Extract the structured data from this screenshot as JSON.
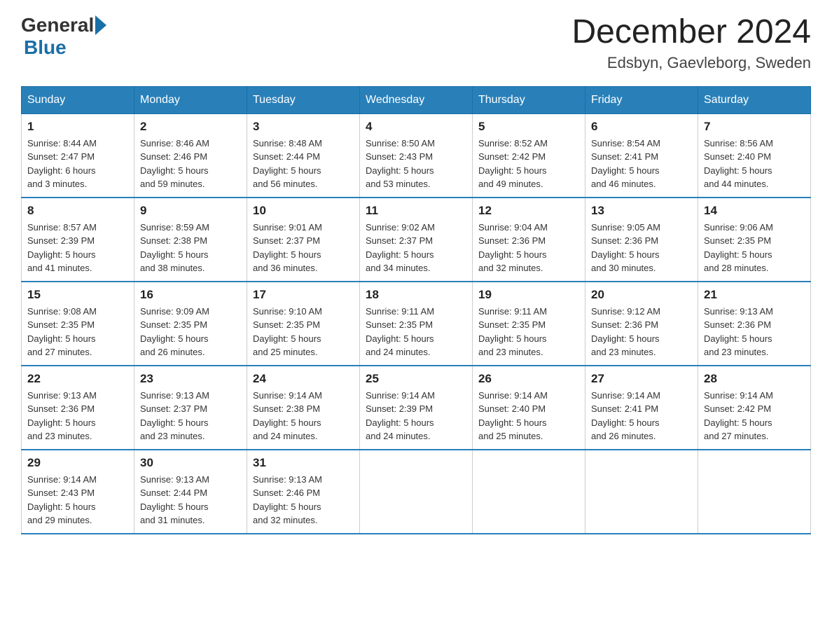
{
  "logo": {
    "general": "General",
    "blue": "Blue"
  },
  "title": "December 2024",
  "subtitle": "Edsbyn, Gaevleborg, Sweden",
  "days_of_week": [
    "Sunday",
    "Monday",
    "Tuesday",
    "Wednesday",
    "Thursday",
    "Friday",
    "Saturday"
  ],
  "weeks": [
    [
      {
        "day": "1",
        "sunrise": "Sunrise: 8:44 AM",
        "sunset": "Sunset: 2:47 PM",
        "daylight": "Daylight: 6 hours",
        "daylight2": "and 3 minutes."
      },
      {
        "day": "2",
        "sunrise": "Sunrise: 8:46 AM",
        "sunset": "Sunset: 2:46 PM",
        "daylight": "Daylight: 5 hours",
        "daylight2": "and 59 minutes."
      },
      {
        "day": "3",
        "sunrise": "Sunrise: 8:48 AM",
        "sunset": "Sunset: 2:44 PM",
        "daylight": "Daylight: 5 hours",
        "daylight2": "and 56 minutes."
      },
      {
        "day": "4",
        "sunrise": "Sunrise: 8:50 AM",
        "sunset": "Sunset: 2:43 PM",
        "daylight": "Daylight: 5 hours",
        "daylight2": "and 53 minutes."
      },
      {
        "day": "5",
        "sunrise": "Sunrise: 8:52 AM",
        "sunset": "Sunset: 2:42 PM",
        "daylight": "Daylight: 5 hours",
        "daylight2": "and 49 minutes."
      },
      {
        "day": "6",
        "sunrise": "Sunrise: 8:54 AM",
        "sunset": "Sunset: 2:41 PM",
        "daylight": "Daylight: 5 hours",
        "daylight2": "and 46 minutes."
      },
      {
        "day": "7",
        "sunrise": "Sunrise: 8:56 AM",
        "sunset": "Sunset: 2:40 PM",
        "daylight": "Daylight: 5 hours",
        "daylight2": "and 44 minutes."
      }
    ],
    [
      {
        "day": "8",
        "sunrise": "Sunrise: 8:57 AM",
        "sunset": "Sunset: 2:39 PM",
        "daylight": "Daylight: 5 hours",
        "daylight2": "and 41 minutes."
      },
      {
        "day": "9",
        "sunrise": "Sunrise: 8:59 AM",
        "sunset": "Sunset: 2:38 PM",
        "daylight": "Daylight: 5 hours",
        "daylight2": "and 38 minutes."
      },
      {
        "day": "10",
        "sunrise": "Sunrise: 9:01 AM",
        "sunset": "Sunset: 2:37 PM",
        "daylight": "Daylight: 5 hours",
        "daylight2": "and 36 minutes."
      },
      {
        "day": "11",
        "sunrise": "Sunrise: 9:02 AM",
        "sunset": "Sunset: 2:37 PM",
        "daylight": "Daylight: 5 hours",
        "daylight2": "and 34 minutes."
      },
      {
        "day": "12",
        "sunrise": "Sunrise: 9:04 AM",
        "sunset": "Sunset: 2:36 PM",
        "daylight": "Daylight: 5 hours",
        "daylight2": "and 32 minutes."
      },
      {
        "day": "13",
        "sunrise": "Sunrise: 9:05 AM",
        "sunset": "Sunset: 2:36 PM",
        "daylight": "Daylight: 5 hours",
        "daylight2": "and 30 minutes."
      },
      {
        "day": "14",
        "sunrise": "Sunrise: 9:06 AM",
        "sunset": "Sunset: 2:35 PM",
        "daylight": "Daylight: 5 hours",
        "daylight2": "and 28 minutes."
      }
    ],
    [
      {
        "day": "15",
        "sunrise": "Sunrise: 9:08 AM",
        "sunset": "Sunset: 2:35 PM",
        "daylight": "Daylight: 5 hours",
        "daylight2": "and 27 minutes."
      },
      {
        "day": "16",
        "sunrise": "Sunrise: 9:09 AM",
        "sunset": "Sunset: 2:35 PM",
        "daylight": "Daylight: 5 hours",
        "daylight2": "and 26 minutes."
      },
      {
        "day": "17",
        "sunrise": "Sunrise: 9:10 AM",
        "sunset": "Sunset: 2:35 PM",
        "daylight": "Daylight: 5 hours",
        "daylight2": "and 25 minutes."
      },
      {
        "day": "18",
        "sunrise": "Sunrise: 9:11 AM",
        "sunset": "Sunset: 2:35 PM",
        "daylight": "Daylight: 5 hours",
        "daylight2": "and 24 minutes."
      },
      {
        "day": "19",
        "sunrise": "Sunrise: 9:11 AM",
        "sunset": "Sunset: 2:35 PM",
        "daylight": "Daylight: 5 hours",
        "daylight2": "and 23 minutes."
      },
      {
        "day": "20",
        "sunrise": "Sunrise: 9:12 AM",
        "sunset": "Sunset: 2:36 PM",
        "daylight": "Daylight: 5 hours",
        "daylight2": "and 23 minutes."
      },
      {
        "day": "21",
        "sunrise": "Sunrise: 9:13 AM",
        "sunset": "Sunset: 2:36 PM",
        "daylight": "Daylight: 5 hours",
        "daylight2": "and 23 minutes."
      }
    ],
    [
      {
        "day": "22",
        "sunrise": "Sunrise: 9:13 AM",
        "sunset": "Sunset: 2:36 PM",
        "daylight": "Daylight: 5 hours",
        "daylight2": "and 23 minutes."
      },
      {
        "day": "23",
        "sunrise": "Sunrise: 9:13 AM",
        "sunset": "Sunset: 2:37 PM",
        "daylight": "Daylight: 5 hours",
        "daylight2": "and 23 minutes."
      },
      {
        "day": "24",
        "sunrise": "Sunrise: 9:14 AM",
        "sunset": "Sunset: 2:38 PM",
        "daylight": "Daylight: 5 hours",
        "daylight2": "and 24 minutes."
      },
      {
        "day": "25",
        "sunrise": "Sunrise: 9:14 AM",
        "sunset": "Sunset: 2:39 PM",
        "daylight": "Daylight: 5 hours",
        "daylight2": "and 24 minutes."
      },
      {
        "day": "26",
        "sunrise": "Sunrise: 9:14 AM",
        "sunset": "Sunset: 2:40 PM",
        "daylight": "Daylight: 5 hours",
        "daylight2": "and 25 minutes."
      },
      {
        "day": "27",
        "sunrise": "Sunrise: 9:14 AM",
        "sunset": "Sunset: 2:41 PM",
        "daylight": "Daylight: 5 hours",
        "daylight2": "and 26 minutes."
      },
      {
        "day": "28",
        "sunrise": "Sunrise: 9:14 AM",
        "sunset": "Sunset: 2:42 PM",
        "daylight": "Daylight: 5 hours",
        "daylight2": "and 27 minutes."
      }
    ],
    [
      {
        "day": "29",
        "sunrise": "Sunrise: 9:14 AM",
        "sunset": "Sunset: 2:43 PM",
        "daylight": "Daylight: 5 hours",
        "daylight2": "and 29 minutes."
      },
      {
        "day": "30",
        "sunrise": "Sunrise: 9:13 AM",
        "sunset": "Sunset: 2:44 PM",
        "daylight": "Daylight: 5 hours",
        "daylight2": "and 31 minutes."
      },
      {
        "day": "31",
        "sunrise": "Sunrise: 9:13 AM",
        "sunset": "Sunset: 2:46 PM",
        "daylight": "Daylight: 5 hours",
        "daylight2": "and 32 minutes."
      },
      null,
      null,
      null,
      null
    ]
  ]
}
